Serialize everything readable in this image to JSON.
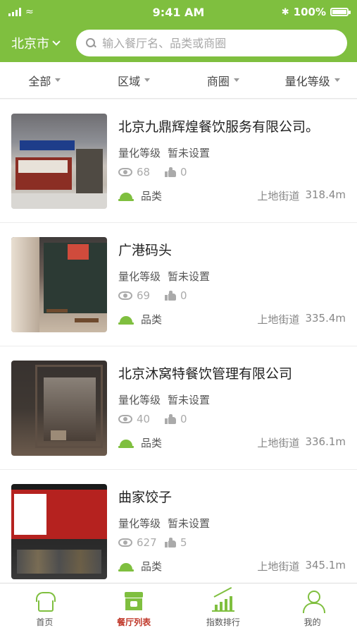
{
  "status_bar": {
    "time": "9:41 AM",
    "battery": "100%"
  },
  "header": {
    "city": "北京市",
    "search_placeholder": "输入餐厅名、品类或商圈"
  },
  "filters": [
    {
      "label": "全部"
    },
    {
      "label": "区域"
    },
    {
      "label": "商圈"
    },
    {
      "label": "量化等级"
    }
  ],
  "restaurants": [
    {
      "name": "北京九鼎辉煌餐饮服务有限公司。",
      "grade_label": "量化等级",
      "grade_value": "暂未设置",
      "views": "68",
      "likes": "0",
      "category_label": "品类",
      "street": "上地街道",
      "distance": "318.4m"
    },
    {
      "name": "广港码头",
      "grade_label": "量化等级",
      "grade_value": "暂未设置",
      "views": "69",
      "likes": "0",
      "category_label": "品类",
      "street": "上地街道",
      "distance": "335.4m"
    },
    {
      "name": "北京沐窝特餐饮管理有限公司",
      "grade_label": "量化等级",
      "grade_value": "暂未设置",
      "views": "40",
      "likes": "0",
      "category_label": "品类",
      "street": "上地街道",
      "distance": "336.1m"
    },
    {
      "name": "曲家饺子",
      "grade_label": "量化等级",
      "grade_value": "暂未设置",
      "views": "627",
      "likes": "5",
      "category_label": "品类",
      "street": "上地街道",
      "distance": "345.1m"
    }
  ],
  "tabbar": [
    {
      "label": "首页",
      "icon": "chef-hat-icon"
    },
    {
      "label": "餐厅列表",
      "icon": "storefront-icon",
      "active": true
    },
    {
      "label": "指数排行",
      "icon": "ranking-chart-icon"
    },
    {
      "label": "我的",
      "icon": "user-icon"
    }
  ],
  "colors": {
    "brand_green": "#7fbf3f",
    "active_tab": "#c0392b"
  }
}
